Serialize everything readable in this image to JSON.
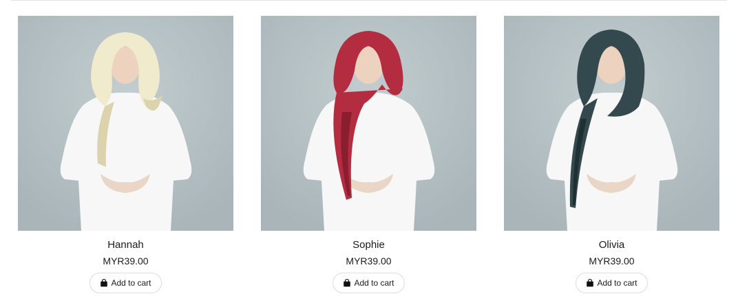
{
  "products": [
    {
      "name": "Hannah",
      "price": "MYR39.00",
      "cart_label": "Add to cart",
      "scarf_color": "#f1ebcd",
      "scarf_shade": "#dcd3ac"
    },
    {
      "name": "Sophie",
      "price": "MYR39.00",
      "cart_label": "Add to cart",
      "scarf_color": "#b32c3f",
      "scarf_shade": "#8a1d2e"
    },
    {
      "name": "Olivia",
      "price": "MYR39.00",
      "cart_label": "Add to cart",
      "scarf_color": "#33494d",
      "scarf_shade": "#1f3033"
    }
  ],
  "colors": {
    "photo_background": "#b6c1c5",
    "dress": "#f7f7f7"
  },
  "icons": {
    "cart": "shopping-bag-icon"
  }
}
